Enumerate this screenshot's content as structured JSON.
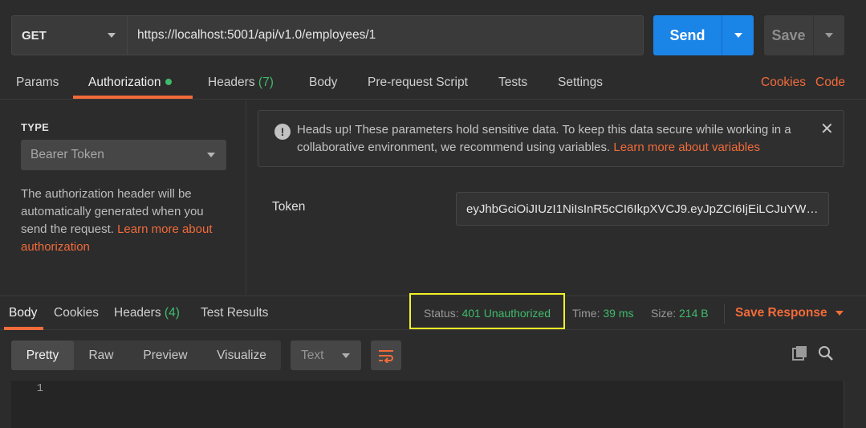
{
  "request": {
    "method": "GET",
    "url": "https://localhost:5001/api/v1.0/employees/1",
    "send_label": "Send",
    "save_label": "Save"
  },
  "request_tabs": {
    "params": "Params",
    "authorization": "Authorization",
    "headers": "Headers",
    "headers_count": "(7)",
    "body": "Body",
    "prerequest": "Pre-request Script",
    "tests": "Tests",
    "settings": "Settings",
    "cookies": "Cookies",
    "code": "Code"
  },
  "auth": {
    "type_label": "TYPE",
    "type_value": "Bearer Token",
    "description": "The authorization header will be automatically generated when you send the request.",
    "learn_more": "Learn more about authorization",
    "notice_text": "Heads up! These parameters hold sensitive data. To keep this data secure while working in a collaborative environment, we recommend using variables.",
    "notice_link": "Learn more about variables",
    "token_label": "Token",
    "token_value": "eyJhbGciOiJIUzI1NiIsInR5cCI6IkpXVCJ9.eyJpZCI6IjEiLCJuYW1laW…"
  },
  "response_tabs": {
    "body": "Body",
    "cookies": "Cookies",
    "headers": "Headers",
    "headers_count": "(4)",
    "test_results": "Test Results"
  },
  "response_meta": {
    "status_label": "Status:",
    "status_value": "401 Unauthorized",
    "time_label": "Time:",
    "time_value": "39 ms",
    "size_label": "Size:",
    "size_value": "214 B",
    "save_response": "Save Response"
  },
  "view": {
    "pretty": "Pretty",
    "raw": "Raw",
    "preview": "Preview",
    "visualize": "Visualize",
    "format": "Text"
  },
  "editor": {
    "line_number": "1"
  },
  "colors": {
    "accent": "#f26b3a",
    "primary": "#1b84e7",
    "success": "#3fbb6b",
    "highlight": "#f3f324"
  }
}
